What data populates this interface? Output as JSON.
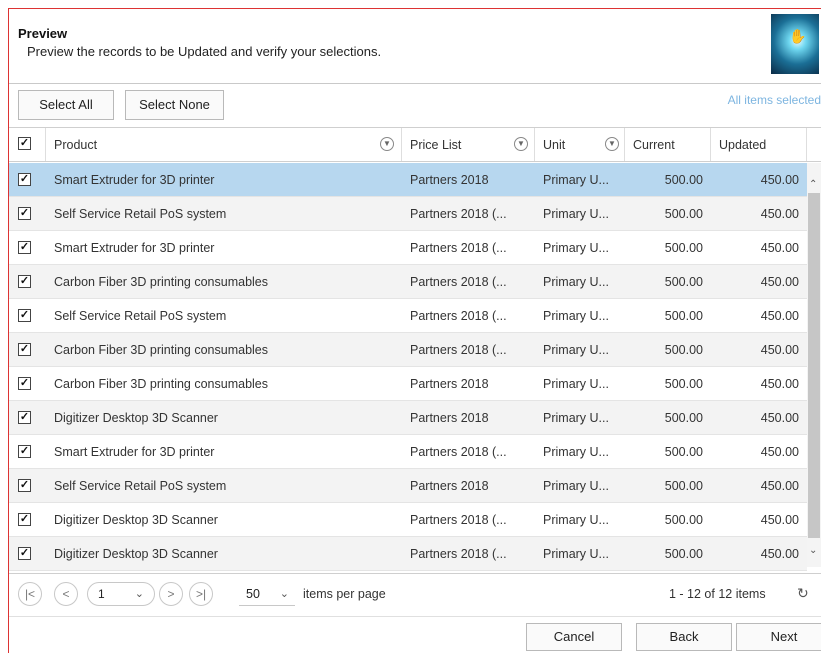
{
  "header": {
    "title": "Preview",
    "subtitle": "Preview the records to be Updated and verify your selections."
  },
  "toolbar": {
    "select_all": "Select All",
    "select_none": "Select None",
    "status": "All items selected"
  },
  "columns": {
    "product": "Product",
    "price_list": "Price List",
    "unit": "Unit",
    "current": "Current",
    "updated": "Updated"
  },
  "rows": [
    {
      "product": "Smart Extruder for 3D printer",
      "price_list": "Partners 2018",
      "unit": "Primary U...",
      "current": "500.00",
      "updated": "450.00",
      "selected": true
    },
    {
      "product": "Self Service Retail PoS system",
      "price_list": "Partners 2018 (...",
      "unit": "Primary U...",
      "current": "500.00",
      "updated": "450.00"
    },
    {
      "product": "Smart Extruder for 3D printer",
      "price_list": "Partners 2018 (...",
      "unit": "Primary U...",
      "current": "500.00",
      "updated": "450.00"
    },
    {
      "product": "Carbon Fiber 3D printing consumables",
      "price_list": "Partners 2018 (...",
      "unit": "Primary U...",
      "current": "500.00",
      "updated": "450.00"
    },
    {
      "product": "Self Service Retail PoS system",
      "price_list": "Partners 2018 (...",
      "unit": "Primary U...",
      "current": "500.00",
      "updated": "450.00"
    },
    {
      "product": "Carbon Fiber 3D printing consumables",
      "price_list": "Partners 2018 (...",
      "unit": "Primary U...",
      "current": "500.00",
      "updated": "450.00"
    },
    {
      "product": "Carbon Fiber 3D printing consumables",
      "price_list": "Partners 2018",
      "unit": "Primary U...",
      "current": "500.00",
      "updated": "450.00"
    },
    {
      "product": "Digitizer Desktop 3D Scanner",
      "price_list": "Partners 2018",
      "unit": "Primary U...",
      "current": "500.00",
      "updated": "450.00"
    },
    {
      "product": "Smart Extruder for 3D printer",
      "price_list": "Partners 2018 (...",
      "unit": "Primary U...",
      "current": "500.00",
      "updated": "450.00"
    },
    {
      "product": "Self Service Retail PoS system",
      "price_list": "Partners 2018",
      "unit": "Primary U...",
      "current": "500.00",
      "updated": "450.00"
    },
    {
      "product": "Digitizer Desktop 3D Scanner",
      "price_list": "Partners 2018 (...",
      "unit": "Primary U...",
      "current": "500.00",
      "updated": "450.00"
    },
    {
      "product": "Digitizer Desktop 3D Scanner",
      "price_list": "Partners 2018 (...",
      "unit": "Primary U...",
      "current": "500.00",
      "updated": "450.00"
    }
  ],
  "pager": {
    "first": "|<",
    "prev": "<",
    "page": "1",
    "next": ">",
    "last": ">|",
    "per_page": "50",
    "per_page_label": "items per page",
    "count": "1 - 12 of 12 items"
  },
  "footer": {
    "cancel": "Cancel",
    "back": "Back",
    "next": "Next"
  },
  "icons": {
    "checkbox": "checked-checkbox-icon",
    "filter": "filter-icon",
    "refresh": "refresh-icon",
    "dropdown": "chevron-down-icon"
  },
  "colors": {
    "selected_row": "#b7d7ef",
    "alt_row": "#f3f3f3",
    "status_text": "#7db5e0",
    "frame_border": "#dd3333"
  }
}
